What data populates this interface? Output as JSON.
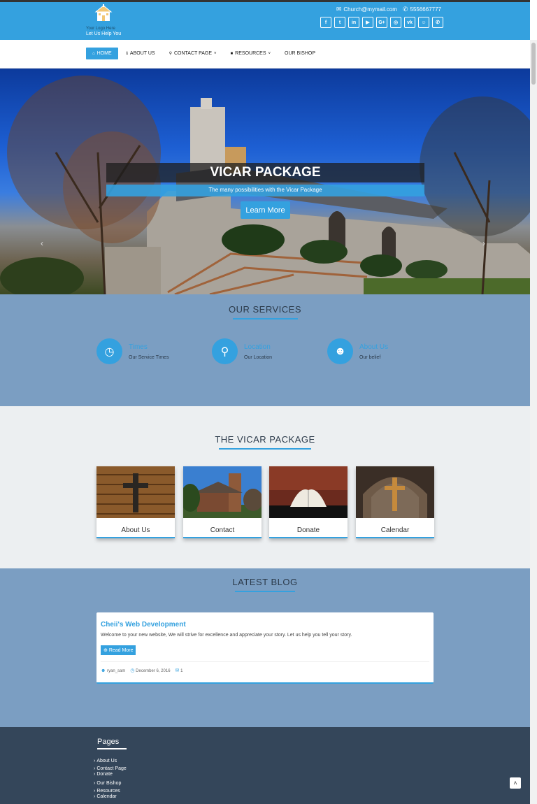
{
  "header": {
    "logo_text": "Your Logo Here",
    "tagline": "Let Us Help You",
    "email": "Church@mymail.com",
    "phone": "5556667777",
    "socials": [
      {
        "icon": "facebook-icon",
        "glyph": "f"
      },
      {
        "icon": "twitter-icon",
        "glyph": "t"
      },
      {
        "icon": "linkedin-icon",
        "glyph": "in"
      },
      {
        "icon": "youtube-icon",
        "glyph": "▶"
      },
      {
        "icon": "google-plus-icon",
        "glyph": "G+"
      },
      {
        "icon": "instagram-icon",
        "glyph": "◎"
      },
      {
        "icon": "vk-icon",
        "glyph": "vk"
      },
      {
        "icon": "snapchat-icon",
        "glyph": "☺"
      },
      {
        "icon": "whatsapp-icon",
        "glyph": "✆"
      }
    ]
  },
  "nav": {
    "items": [
      {
        "label": "Home",
        "icon": "home-icon",
        "glyph": "⌂",
        "active": true
      },
      {
        "label": "About Us",
        "icon": "info-icon",
        "glyph": "ℹ"
      },
      {
        "label": "Contact Page",
        "icon": "map-pin-icon",
        "glyph": "⚲",
        "dropdown": true
      },
      {
        "label": "Resources",
        "icon": "cube-icon",
        "glyph": "■",
        "dropdown": true
      },
      {
        "label": "Our Bishop"
      }
    ]
  },
  "hero": {
    "title": "VICAR PACKAGE",
    "subtitle": "The many possibilities with the Vicar Package",
    "button": "Learn More"
  },
  "services": {
    "title": "OUR SERVICES",
    "items": [
      {
        "name": "Times",
        "desc": "Our Service Times",
        "icon": "clock-icon",
        "glyph": "◷"
      },
      {
        "name": "Location",
        "desc": "Our Location",
        "icon": "map-marker-icon",
        "glyph": "⚲"
      },
      {
        "name": "About Us",
        "desc": "Our belief",
        "icon": "users-icon",
        "glyph": "☻"
      }
    ]
  },
  "package": {
    "title": "THE VICAR PACKAGE",
    "cards": [
      {
        "label": "About Us"
      },
      {
        "label": "Contact"
      },
      {
        "label": "Donate"
      },
      {
        "label": "Calendar"
      }
    ]
  },
  "blog": {
    "title": "LATEST BLOG",
    "post": {
      "title": "Cheii's Web Development",
      "text": "Welcome to your new website, We will strive for excellence and appreciate your story. Let us help you tell your story.",
      "button": "Read More",
      "author": "ryan_sam",
      "date": "December 6, 2016",
      "comments": "1"
    }
  },
  "footer": {
    "title": "Pages",
    "links": [
      "About Us",
      "Contact Page",
      "Donate",
      "Our Bishop",
      "Resources",
      "Calendar"
    ]
  },
  "colors": {
    "accent": "#34a1df",
    "services_bg": "#7b9ec2",
    "footer_bg": "#34465a"
  }
}
